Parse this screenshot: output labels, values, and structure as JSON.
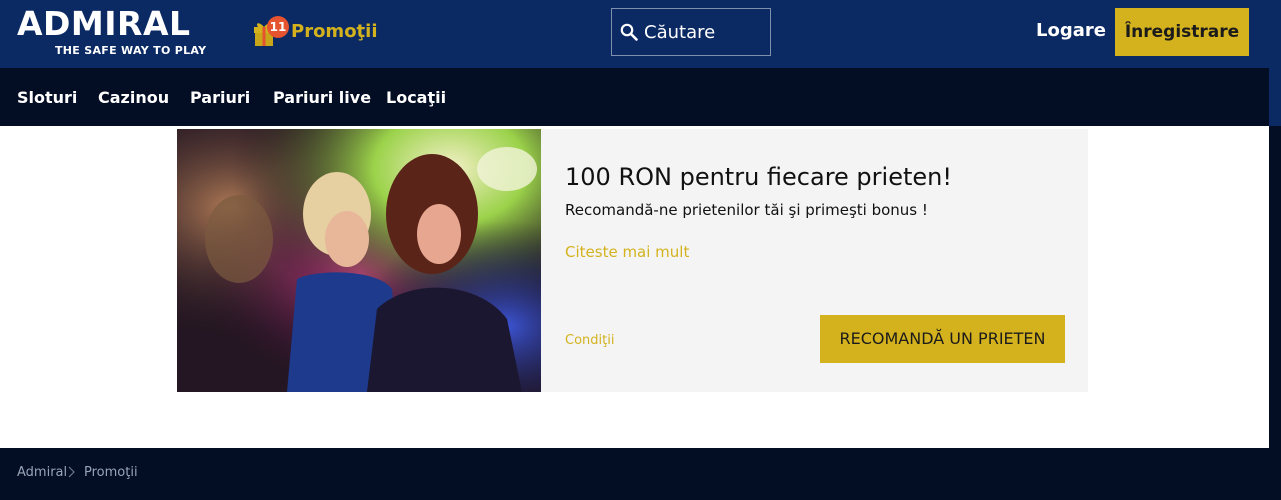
{
  "header": {
    "logo": {
      "word": "ADMIRAL",
      "tagline": "THE SAFE WAY TO PLAY"
    },
    "promotions": {
      "badge_count": "11",
      "label": "Promoţii",
      "icon": "gift-icon"
    },
    "search": {
      "placeholder": "Căutare",
      "icon": "search-icon"
    },
    "login_label": "Logare",
    "register_label": "Înregistrare"
  },
  "nav": {
    "items": [
      {
        "label": "Sloturi"
      },
      {
        "label": "Cazinou"
      },
      {
        "label": "Pariuri"
      },
      {
        "label": "Pariuri live"
      },
      {
        "label": "Locaţii"
      }
    ]
  },
  "promo_card": {
    "title": "100 RON pentru fiecare prieten!",
    "subtitle": "Recomandă-ne prietenilor tăi şi primeşti bonus !",
    "read_more": "Citeste mai mult",
    "conditions": "Condiţii",
    "cta": "RECOMANDĂ UN PRIETEN"
  },
  "breadcrumb": {
    "items": [
      {
        "label": "Admiral"
      },
      {
        "label": "Promoţii"
      }
    ]
  },
  "colors": {
    "header_bg": "#0b2a63",
    "nav_bg": "#030d24",
    "accent_gold": "#d4b21e",
    "badge_red": "#e5532f",
    "card_bg": "#f4f4f4"
  }
}
